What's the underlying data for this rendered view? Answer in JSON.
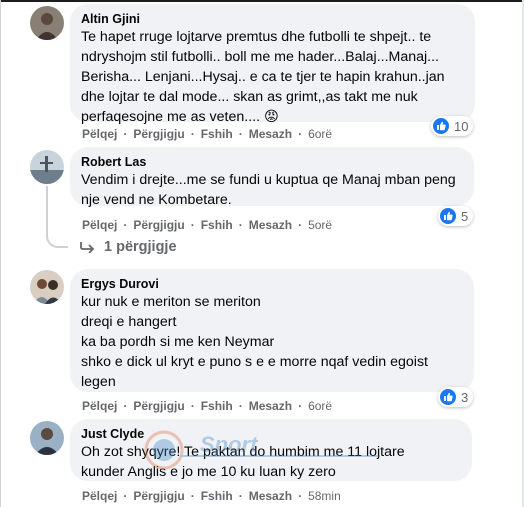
{
  "comments": [
    {
      "author": "Altin Gjini",
      "text": "Te hapet rruge lojtarve premtus dhe futbolli te shpejt.. te ndryshojm stil futbolli.. boll me me hader...Balaj...Manaj... Berisha... Lenjani...Hysaj.. e ca te tjer te hapin krahun..jan dhe lojtar te dal mode... skan as grimt,,as takt me nuk perfaqesojne me as veten....",
      "emoji": "😡",
      "actions": {
        "like": "Pëlqej",
        "reply": "Përgjigju",
        "hide": "Fshih",
        "message": "Mesazh"
      },
      "time": "6orë",
      "reaction_count": "10"
    },
    {
      "author": "Robert Las",
      "text": "Vendim i drejte...me se fundi u kuptua qe Manaj mban peng nje vend ne Kombetare.",
      "actions": {
        "like": "Pëlqej",
        "reply": "Përgjigju",
        "hide": "Fshih",
        "message": "Mesazh"
      },
      "time": "5orë",
      "reaction_count": "5",
      "replies_label": "1 përgjigje"
    },
    {
      "author": "Ergys Durovi",
      "text": "kur nuk e meriton se meriton\ndreqi e hangert\nka ba pordh si me ken Neymar\nshko e dick ul kryt e puno s e e morre nqaf vedin egoist\nlegen",
      "actions": {
        "like": "Pëlqej",
        "reply": "Përgjigju",
        "hide": "Fshih",
        "message": "Mesazh"
      },
      "time": "6orë",
      "reaction_count": "3"
    },
    {
      "author": "Just Clyde",
      "text": "Oh zot shyqyre! Te paktan do humbim me 11 lojtare\nkunder Anglis e jo me 10 ku luan ky zero",
      "actions": {
        "like": "Pëlqej",
        "reply": "Përgjigju",
        "hide": "Fshih",
        "message": "Mesazh"
      },
      "time": "58min"
    }
  ],
  "watermark_text": "Sport",
  "colors": {
    "bubble": "#f0f2f5",
    "secondary_text": "#65676b",
    "like_blue": "#1877f2"
  }
}
